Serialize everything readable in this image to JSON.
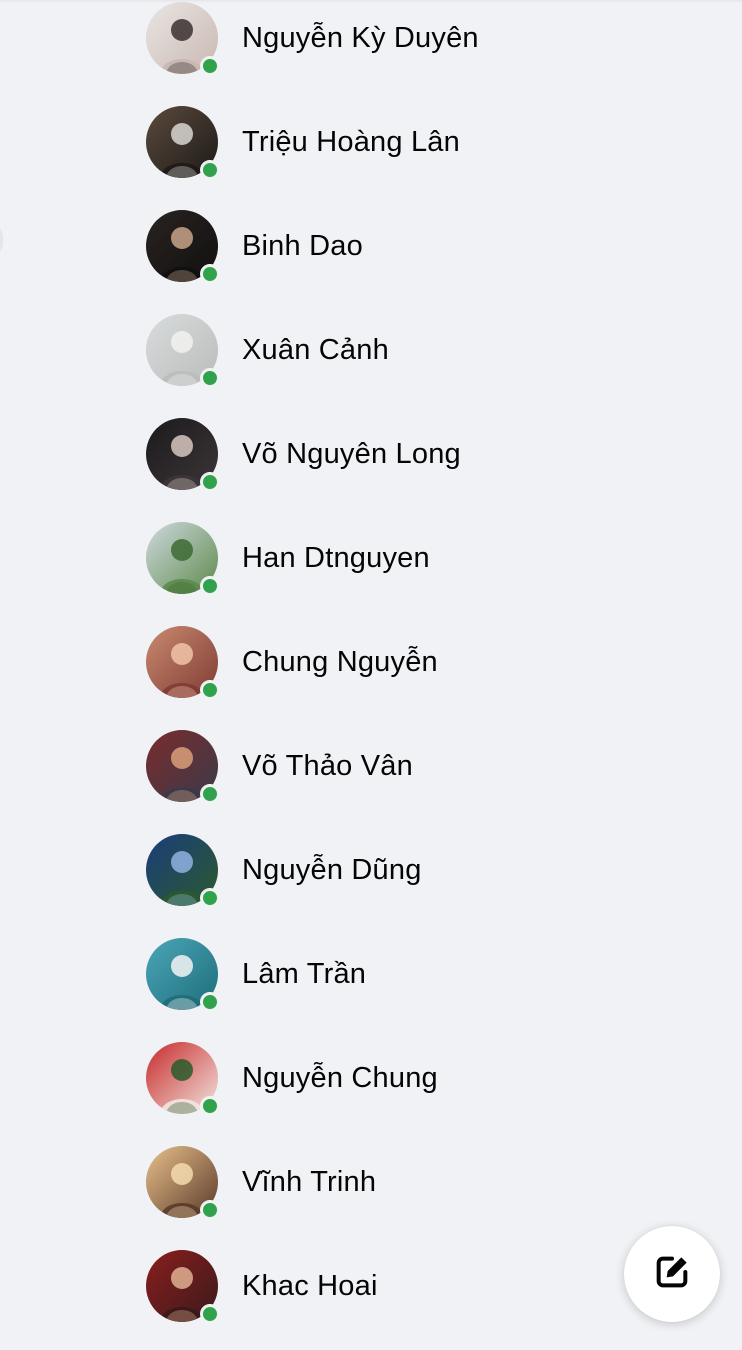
{
  "contacts": [
    {
      "name": "Nguyễn Kỳ Duyên",
      "online": true,
      "avatar_icon": "person-striped-shirt-avatar",
      "avatar_colors": [
        "#e9e6e4",
        "#c9b7b0",
        "#3a3030"
      ]
    },
    {
      "name": "Triệu Hoàng Lân",
      "online": true,
      "avatar_icon": "person-sunglasses-avatar",
      "avatar_colors": [
        "#5b4a3c",
        "#1d1a18",
        "#d9d6d2"
      ]
    },
    {
      "name": "Binh Dao",
      "online": true,
      "avatar_icon": "person-cap-avatar",
      "avatar_colors": [
        "#2a2320",
        "#101010",
        "#c8a58a"
      ]
    },
    {
      "name": "Xuân Cảnh",
      "online": true,
      "avatar_icon": "person-beach-avatar",
      "avatar_colors": [
        "#d9dcdc",
        "#b9bcbb",
        "#f2f2f0"
      ]
    },
    {
      "name": "Võ Nguyên Long",
      "online": true,
      "avatar_icon": "person-dark-avatar",
      "avatar_colors": [
        "#1c1a1c",
        "#3c3538",
        "#d8c7c0"
      ]
    },
    {
      "name": "Han Dtnguyen",
      "online": true,
      "avatar_icon": "field-landscape-avatar",
      "avatar_colors": [
        "#cfd9de",
        "#5d8a4c",
        "#3d6a34"
      ]
    },
    {
      "name": "Chung Nguyễn",
      "online": true,
      "avatar_icon": "person-selfie-avatar",
      "avatar_colors": [
        "#c98a6f",
        "#7f3b34",
        "#f0c4a8"
      ]
    },
    {
      "name": "Võ Thảo Vân",
      "online": true,
      "avatar_icon": "family-group-avatar",
      "avatar_colors": [
        "#7a2c2c",
        "#3a3a4a",
        "#d9a07a"
      ]
    },
    {
      "name": "Nguyễn Dũng",
      "online": true,
      "avatar_icon": "building-night-avatar",
      "avatar_colors": [
        "#1a3d7a",
        "#2b5a2e",
        "#8fb3e0"
      ]
    },
    {
      "name": "Lâm Trần",
      "online": true,
      "avatar_icon": "wedding-beach-avatar",
      "avatar_colors": [
        "#4aa6b8",
        "#1f6d7a",
        "#f4f4f4"
      ]
    },
    {
      "name": "Nguyễn Chung",
      "online": true,
      "avatar_icon": "family-celebration-avatar",
      "avatar_colors": [
        "#c72a2a",
        "#f2e6e0",
        "#2a5a2a"
      ]
    },
    {
      "name": "Vĩnh Trinh",
      "online": true,
      "avatar_icon": "person-sunset-avatar",
      "avatar_colors": [
        "#e8c08a",
        "#5a3a2a",
        "#f4dab0"
      ]
    },
    {
      "name": "Khac Hoai",
      "online": true,
      "avatar_icon": "family-red-avatar",
      "avatar_colors": [
        "#8a1e1e",
        "#3a1a1a",
        "#e0b090"
      ]
    }
  ],
  "compose": {
    "icon": "compose-edit-icon",
    "color": "#050505"
  },
  "status_color": "#31a24c"
}
